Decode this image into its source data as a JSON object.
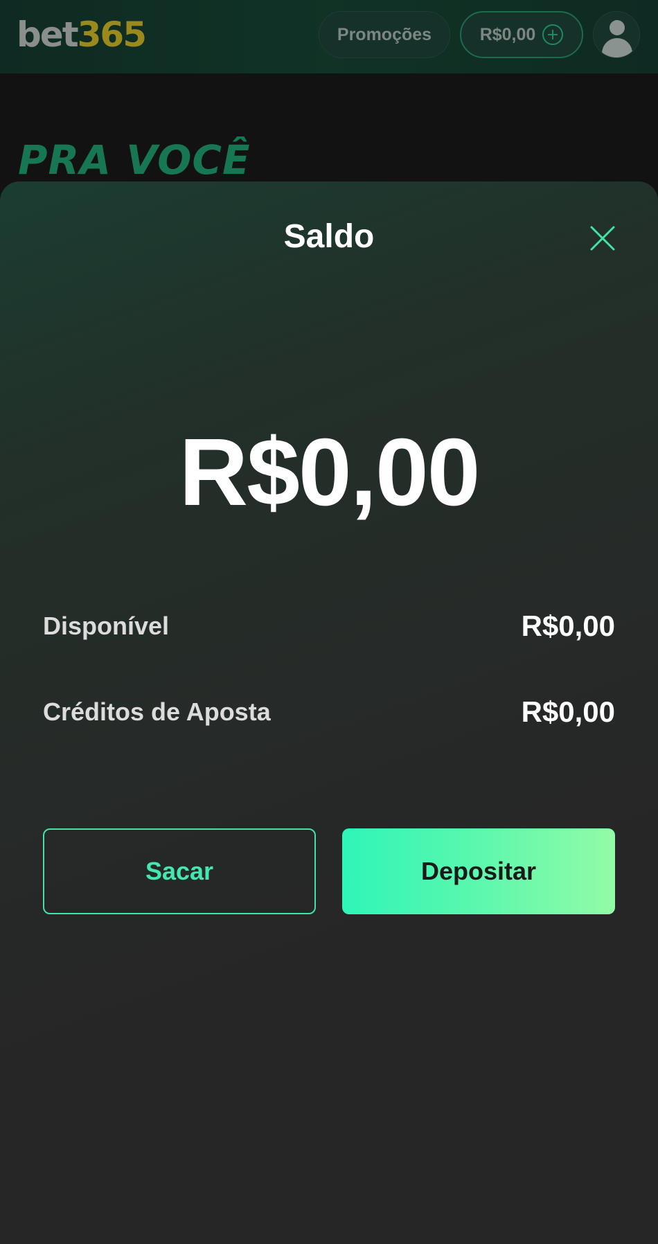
{
  "header": {
    "logo_part1": "bet",
    "logo_part2": "365",
    "promotions_label": "Promoções",
    "balance_label": "R$0,00"
  },
  "section_title": "PRA VOCÊ",
  "sheet": {
    "title": "Saldo",
    "total_balance": "R$0,00",
    "rows": [
      {
        "label": "Disponível",
        "value": "R$0,00"
      },
      {
        "label": "Créditos de Aposta",
        "value": "R$0,00"
      }
    ],
    "withdraw_label": "Sacar",
    "deposit_label": "Depositar"
  },
  "colors": {
    "accent": "#43e3a6",
    "deposit_gradient_start": "#2ff5b9",
    "deposit_gradient_end": "#93fba6",
    "logo_yellow": "#9a8a1e",
    "section_title": "#177752"
  },
  "icons": {
    "close": "close-icon",
    "add_funds": "plus-circle-icon",
    "user": "avatar-icon"
  }
}
